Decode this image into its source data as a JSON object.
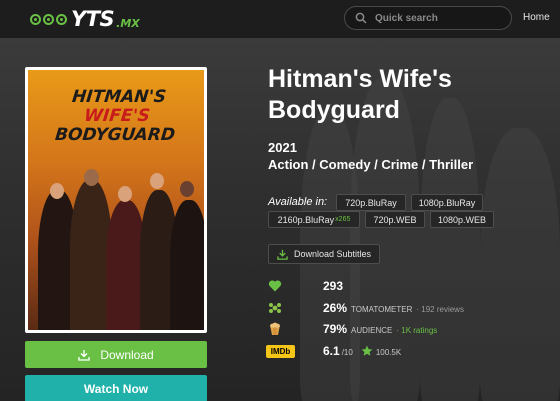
{
  "header": {
    "logo_text": "YTS",
    "logo_tld": ".MX",
    "search_placeholder": "Quick search",
    "nav_home": "Home"
  },
  "poster": {
    "title_line1_a": "HITMAN'S",
    "title_line1_b": "WIFE'S",
    "title_line2": "BODYGUARD"
  },
  "movie": {
    "title": "Hitman's Wife's Bodyguard",
    "year": "2021",
    "genres": "Action / Comedy / Crime / Thriller",
    "available_label": "Available in:",
    "qualities": [
      {
        "label": "720p.BluRay",
        "sub": ""
      },
      {
        "label": "1080p.BluRay",
        "sub": ""
      },
      {
        "label": "2160p.BluRay",
        "sub": "x265"
      },
      {
        "label": "720p.WEB",
        "sub": ""
      },
      {
        "label": "1080p.WEB",
        "sub": ""
      }
    ],
    "subtitles_label": "Download Subtitles"
  },
  "stats": {
    "likes": "293",
    "tomato_score": "26%",
    "tomato_label": "TOMATOMETER",
    "tomato_reviews": "· 192 reviews",
    "audience_score": "79%",
    "audience_label": "AUDIENCE",
    "audience_ratings": "· 1K ratings",
    "imdb_label": "IMDb",
    "imdb_rating": "6.1",
    "imdb_scale": "/10",
    "imdb_votes": "100.5K"
  },
  "buttons": {
    "download": "Download",
    "watch_now": "Watch Now"
  },
  "colors": {
    "accent_green": "#6ac045",
    "watch_teal": "#20b2aa",
    "background": "#1d1d1d"
  }
}
